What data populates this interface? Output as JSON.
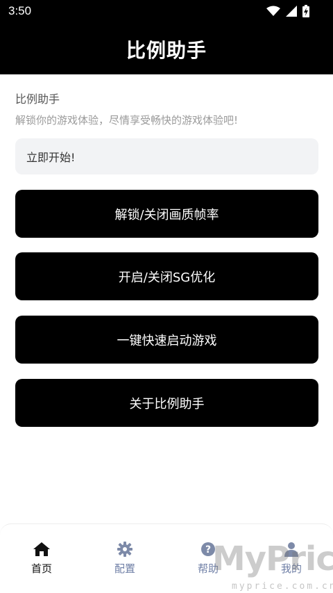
{
  "status_bar": {
    "time": "3:50",
    "icons": [
      "wifi-icon",
      "signal-icon",
      "battery-charging-icon"
    ]
  },
  "app_bar": {
    "title": "比例助手"
  },
  "intro": {
    "title": "比例助手",
    "description": "解锁你的游戏体验，尽情享受畅快的游戏体验吧!"
  },
  "start_box": {
    "label": "立即开始!"
  },
  "actions": [
    {
      "label": "解锁/关闭画质帧率"
    },
    {
      "label": "开启/关闭SG优化"
    },
    {
      "label": "一键快速启动游戏"
    },
    {
      "label": "关于比例助手"
    }
  ],
  "bottom_nav": {
    "items": [
      {
        "label": "首页",
        "icon": "home-icon",
        "active": true
      },
      {
        "label": "配置",
        "icon": "gear-icon",
        "active": false
      },
      {
        "label": "帮助",
        "icon": "help-icon",
        "active": false
      },
      {
        "label": "我的",
        "icon": "person-icon",
        "active": false
      }
    ]
  },
  "watermark": {
    "main": "MyPrice",
    "sub": "myprice.com.cn"
  },
  "colors": {
    "header_bg": "#000000",
    "button_bg": "#000000",
    "start_box_bg": "#f2f3f5",
    "nav_inactive": "#6f7fa6",
    "nav_active": "#111111"
  }
}
